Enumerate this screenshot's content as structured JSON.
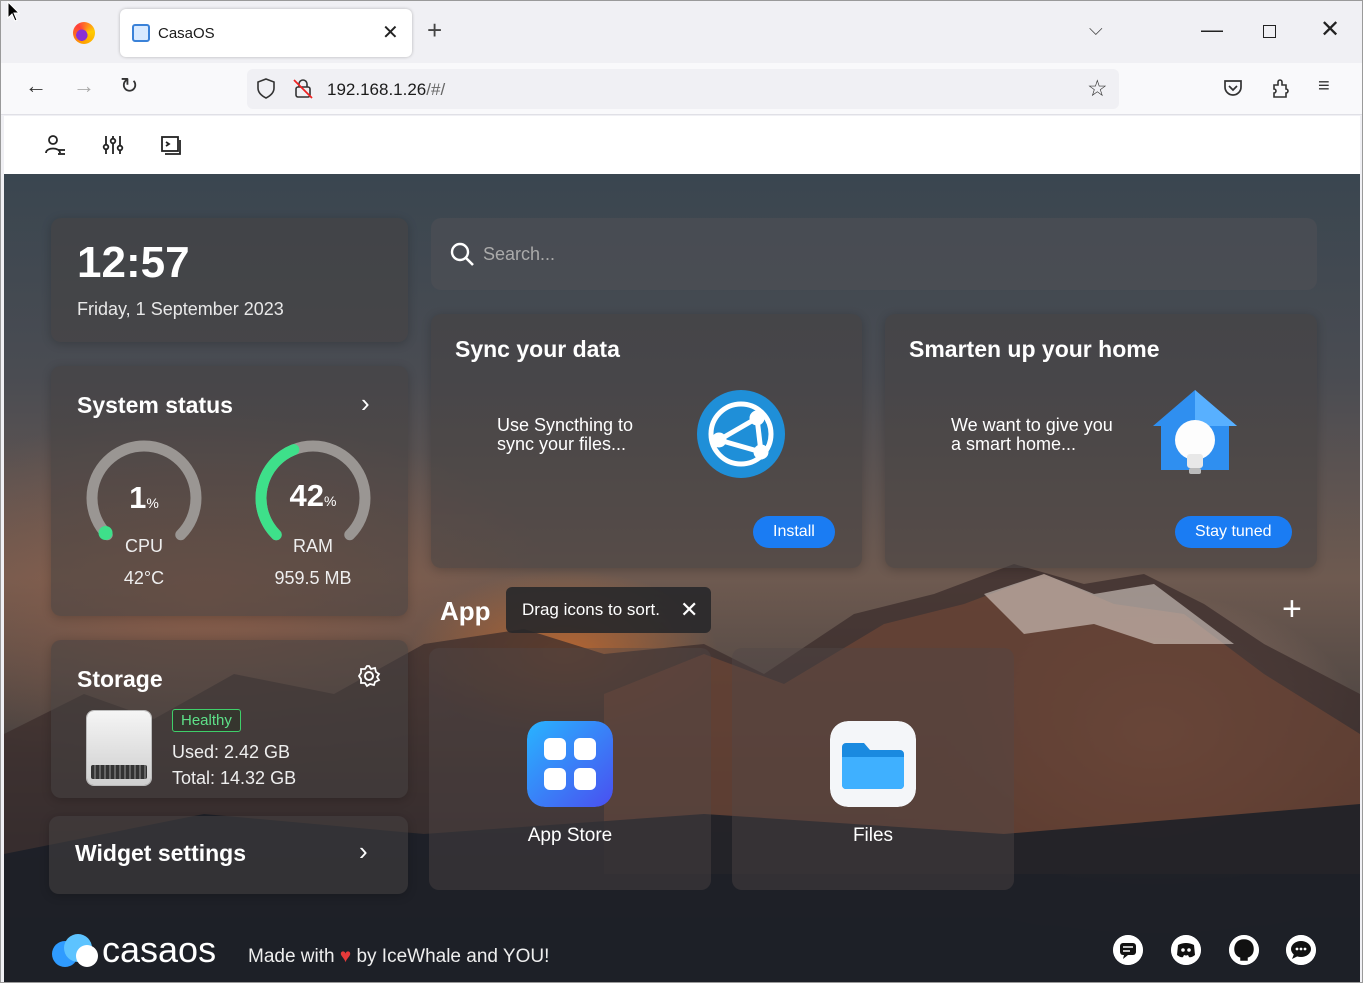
{
  "browser": {
    "tab_title": "CasaOS",
    "url_host": "192.168.1.26",
    "url_path": "/#/",
    "icons": [
      "firefox-icon",
      "new-tab-icon",
      "tab-list-icon",
      "minimize-icon",
      "maximize-icon",
      "close-icon",
      "back-icon",
      "forward-icon",
      "reload-icon",
      "shield-icon",
      "insecure-lock-icon",
      "bookmark-star-icon",
      "pocket-icon",
      "extensions-icon",
      "menu-icon"
    ]
  },
  "toolbar": {
    "icons": [
      "user-settings-icon",
      "sliders-icon",
      "terminal-icon"
    ]
  },
  "clock": {
    "time": "12:57",
    "date": "Friday, 1 September 2023"
  },
  "system_status": {
    "title": "System status",
    "cpu": {
      "value": "1",
      "unit": "%",
      "label": "CPU",
      "sub": "42°C",
      "percent": 1
    },
    "ram": {
      "value": "42",
      "unit": "%",
      "label": "RAM",
      "sub": "959.5 MB",
      "percent": 42
    }
  },
  "storage": {
    "title": "Storage",
    "status": "Healthy",
    "used": "Used: 2.42 GB",
    "total": "Total: 14.32 GB"
  },
  "widget_settings": {
    "title": "Widget settings"
  },
  "search": {
    "placeholder": "Search..."
  },
  "promos": [
    {
      "title": "Sync your data",
      "desc1": "Use Syncthing to",
      "desc2": "sync your files...",
      "button": "Install"
    },
    {
      "title": "Smarten up your home",
      "desc1": "We want to give you",
      "desc2": "a smart home...",
      "button": "Stay tuned"
    }
  ],
  "apps": {
    "section_title": "App",
    "tooltip": "Drag icons to sort.",
    "items": [
      {
        "name": "App Store"
      },
      {
        "name": "Files"
      }
    ]
  },
  "footer": {
    "brand": "casaos",
    "made_with": "Made with",
    "by": "by IceWhale and YOU!",
    "icons": [
      "feedback-icon",
      "discord-icon",
      "github-icon",
      "chat-icon"
    ]
  },
  "colors": {
    "accent": "#1a7cf3",
    "healthy": "#3fcf6a",
    "ram_gauge": "#3ee08a",
    "cpu_dot": "#3ee08a"
  }
}
